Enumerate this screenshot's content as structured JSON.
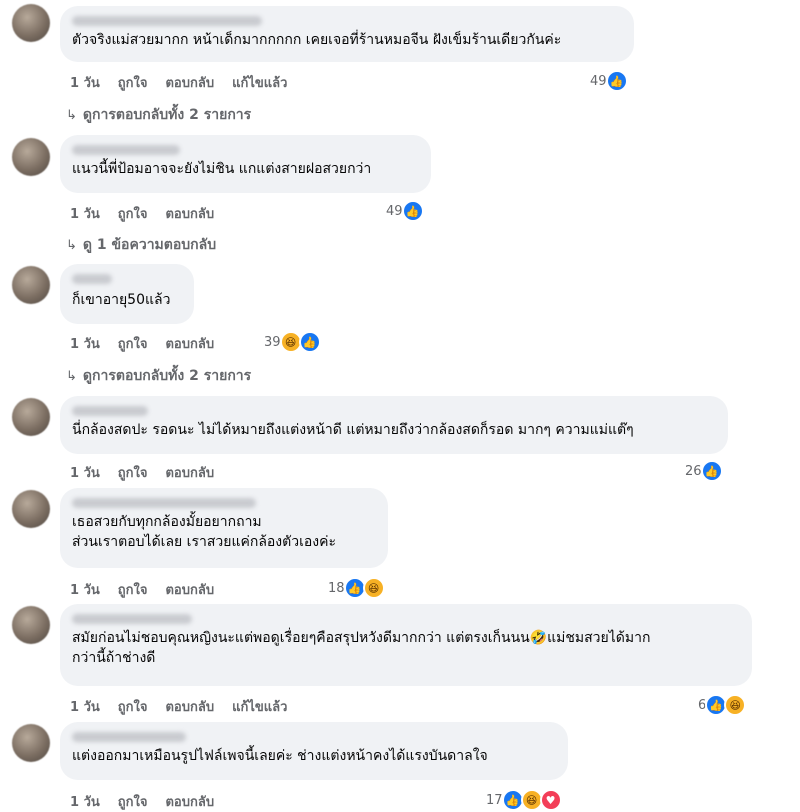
{
  "comments": [
    {
      "text_lines": [
        "ตัวจริงแม่สวยมากก หน้าเด็กมากกกกก เคยเจอที่ร้านหมอจีน ฝังเข็มร้านเดียวกันค่ะ"
      ],
      "actions": {
        "time": "1 วัน",
        "like": "ถูกใจ",
        "reply": "ตอบกลับ",
        "edited": "แก้ไขแล้ว"
      },
      "reaction_count": "49",
      "reactions": [
        "like-icon"
      ],
      "replies_label": "ดูการตอบกลับทั้ง 2 รายการ"
    },
    {
      "text_lines": [
        "แนวนี้พี่ป้อมอาจจะยังไม่ชิน แกแต่งสายฝอสวยกว่า"
      ],
      "actions": {
        "time": "1 วัน",
        "like": "ถูกใจ",
        "reply": "ตอบกลับ"
      },
      "reaction_count": "49",
      "reactions": [
        "like-icon"
      ],
      "replies_label": "ดู 1 ข้อความตอบกลับ"
    },
    {
      "text_lines": [
        "ก็เขาอายุ50แล้ว"
      ],
      "actions": {
        "time": "1 วัน",
        "like": "ถูกใจ",
        "reply": "ตอบกลับ"
      },
      "reaction_count": "39",
      "reactions": [
        "haha-icon",
        "like-icon"
      ],
      "replies_label": "ดูการตอบกลับทั้ง 2 รายการ"
    },
    {
      "text_lines": [
        "นี่กล้องสดปะ รอดนะ ไม่ได้หมายถึงแต่งหน้าดี แต่หมายถึงว่ากล้องสดก็รอด มากๆ ความแม่แต๊ๆ"
      ],
      "actions": {
        "time": "1 วัน",
        "like": "ถูกใจ",
        "reply": "ตอบกลับ"
      },
      "reaction_count": "26",
      "reactions": [
        "like-icon"
      ]
    },
    {
      "text_lines": [
        "เธอสวยกับทุกกล้องมั้ยอยากถาม",
        "ส่วนเราตอบได้เลย เราสวยแค่กล้องตัวเองค่ะ"
      ],
      "actions": {
        "time": "1 วัน",
        "like": "ถูกใจ",
        "reply": "ตอบกลับ"
      },
      "reaction_count": "18",
      "reactions": [
        "like-icon",
        "haha-icon"
      ]
    },
    {
      "text_lines": [
        "สมัยก่อนไม่ชอบคุณหญิงนะแต่พอดูเรื่อยๆคือสรุปหวังดีมากกว่า แต่ตรงเก็นนน🤣แม่ชมสวยได้มาก",
        "กว่านี้ถ้าช่างดี"
      ],
      "actions": {
        "time": "1 วัน",
        "like": "ถูกใจ",
        "reply": "ตอบกลับ",
        "edited": "แก้ไขแล้ว"
      },
      "reaction_count": "6",
      "reactions": [
        "like-icon",
        "haha-icon"
      ]
    },
    {
      "text_lines": [
        "แต่งออกมาเหมือนรูปไฟล์เพจนี้เลยค่ะ ช่างแต่งหน้าคงได้แรงบันดาลใจ"
      ],
      "actions": {
        "time": "1 วัน",
        "like": "ถูกใจ",
        "reply": "ตอบกลับ"
      },
      "reaction_count": "17",
      "reactions": [
        "like-icon",
        "haha-icon",
        "love-icon"
      ]
    }
  ],
  "colors": {
    "bubble": "#f0f2f5",
    "meta": "#65676b",
    "like": "#1877f2",
    "haha": "#f7b125",
    "love": "#f33e58"
  }
}
